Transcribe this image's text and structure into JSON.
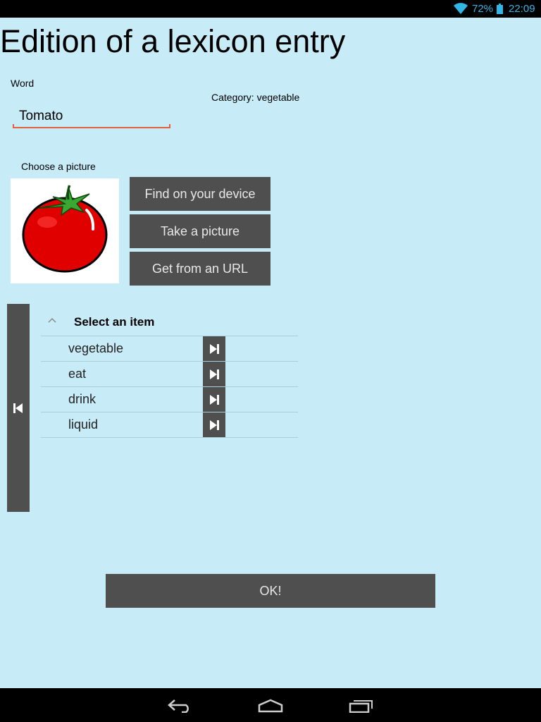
{
  "status_bar": {
    "battery_percent": "72%",
    "time": "22:09",
    "accent_color": "#33b5e5",
    "icons": [
      "wifi-icon",
      "battery-icon"
    ]
  },
  "title": "Edition of a lexicon entry",
  "word": {
    "label": "Word",
    "value": "Tomato"
  },
  "category": "Category: vegetable",
  "picture": {
    "label": "Choose a picture",
    "preview_icon": "tomato-image",
    "buttons": {
      "find": "Find on your device",
      "take": "Take a picture",
      "url": "Get from an URL"
    }
  },
  "selector": {
    "header": "Select an item",
    "items": [
      {
        "label": "vegetable"
      },
      {
        "label": "eat"
      },
      {
        "label": "drink"
      },
      {
        "label": "liquid"
      }
    ]
  },
  "ok_button": "OK!",
  "navigation_bar": {
    "icons": [
      "back-icon",
      "home-icon",
      "recent-apps-icon"
    ]
  },
  "colors": {
    "background": "#c8ebf8",
    "button": "#4f4f4f",
    "input_underline": "#e3623a"
  }
}
